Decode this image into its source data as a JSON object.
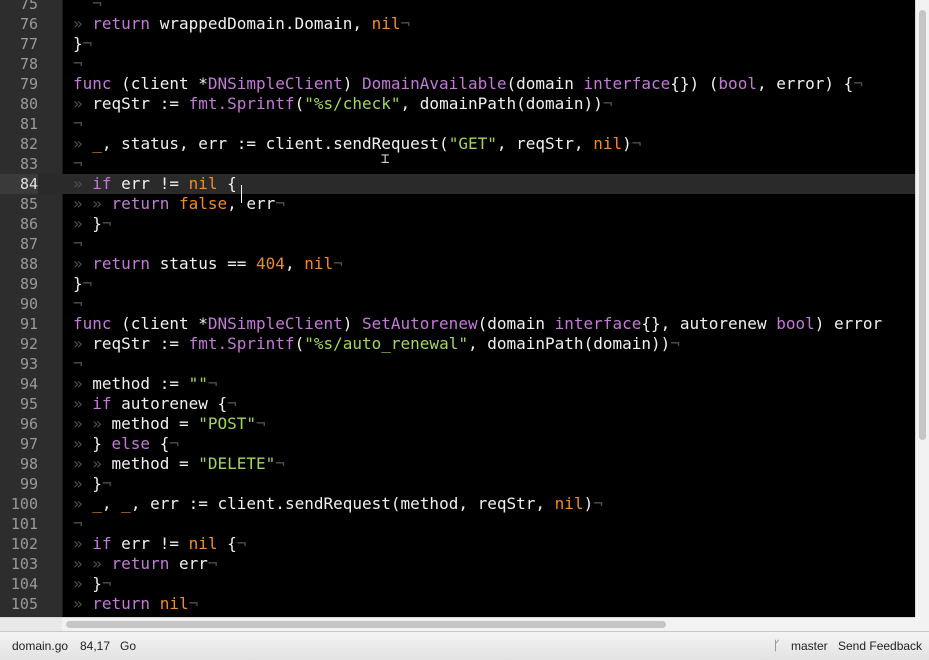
{
  "editor": {
    "current_line": 84,
    "lines": [
      {
        "n": "75",
        "tokens": [
          [
            "ws",
            "  "
          ],
          [
            "eol",
            "¬"
          ]
        ]
      },
      {
        "n": "76",
        "tokens": [
          [
            "ws",
            "» "
          ],
          [
            "kw",
            "return"
          ],
          [
            "text",
            " wrappedDomain.Domain, "
          ],
          [
            "const",
            "nil"
          ],
          [
            "eol",
            "¬"
          ]
        ]
      },
      {
        "n": "77",
        "tokens": [
          [
            "text",
            "}"
          ],
          [
            "eol",
            "¬"
          ]
        ]
      },
      {
        "n": "78",
        "tokens": [
          [
            "eol",
            "¬"
          ]
        ]
      },
      {
        "n": "79",
        "tokens": [
          [
            "kw",
            "func"
          ],
          [
            "text",
            " (client *"
          ],
          [
            "type",
            "DNSimpleClient"
          ],
          [
            "text",
            ") "
          ],
          [
            "fn",
            "DomainAvailable"
          ],
          [
            "text",
            "(domain "
          ],
          [
            "kw",
            "interface"
          ],
          [
            "text",
            "{}) ("
          ],
          [
            "type",
            "bool"
          ],
          [
            "text",
            ", error) {"
          ],
          [
            "eol",
            "¬"
          ]
        ]
      },
      {
        "n": "80",
        "tokens": [
          [
            "ws",
            "» "
          ],
          [
            "text",
            "reqStr := "
          ],
          [
            "fn",
            "fmt.Sprintf"
          ],
          [
            "text",
            "("
          ],
          [
            "str",
            "\"%s/check\""
          ],
          [
            "text",
            ", domainPath(domain))"
          ],
          [
            "eol",
            "¬"
          ]
        ]
      },
      {
        "n": "81",
        "tokens": [
          [
            "eol",
            "¬"
          ]
        ]
      },
      {
        "n": "82",
        "tokens": [
          [
            "ws",
            "» "
          ],
          [
            "const",
            "_"
          ],
          [
            "text",
            ", status, err := client.sendRequest("
          ],
          [
            "str",
            "\"GET\""
          ],
          [
            "text",
            ", reqStr, "
          ],
          [
            "const",
            "nil"
          ],
          [
            "text",
            ")"
          ],
          [
            "eol",
            "¬"
          ]
        ]
      },
      {
        "n": "83",
        "tokens": [
          [
            "eol",
            "¬"
          ]
        ]
      },
      {
        "n": "84",
        "tokens": [
          [
            "ws",
            "» "
          ],
          [
            "kw",
            "if"
          ],
          [
            "text",
            " err != "
          ],
          [
            "const",
            "nil"
          ],
          [
            "text",
            " {"
          ]
        ]
      },
      {
        "n": "85",
        "tokens": [
          [
            "ws",
            "» » "
          ],
          [
            "kw",
            "return"
          ],
          [
            "text",
            " "
          ],
          [
            "const",
            "false"
          ],
          [
            "text",
            ", err"
          ],
          [
            "eol",
            "¬"
          ]
        ]
      },
      {
        "n": "86",
        "tokens": [
          [
            "ws",
            "» "
          ],
          [
            "text",
            "}"
          ],
          [
            "eol",
            "¬"
          ]
        ]
      },
      {
        "n": "87",
        "tokens": [
          [
            "eol",
            "¬"
          ]
        ]
      },
      {
        "n": "88",
        "tokens": [
          [
            "ws",
            "» "
          ],
          [
            "kw",
            "return"
          ],
          [
            "text",
            " status == "
          ],
          [
            "num",
            "404"
          ],
          [
            "text",
            ", "
          ],
          [
            "const",
            "nil"
          ],
          [
            "eol",
            "¬"
          ]
        ]
      },
      {
        "n": "89",
        "tokens": [
          [
            "text",
            "}"
          ],
          [
            "eol",
            "¬"
          ]
        ]
      },
      {
        "n": "90",
        "tokens": [
          [
            "eol",
            "¬"
          ]
        ]
      },
      {
        "n": "91",
        "tokens": [
          [
            "kw",
            "func"
          ],
          [
            "text",
            " (client *"
          ],
          [
            "type",
            "DNSimpleClient"
          ],
          [
            "text",
            ") "
          ],
          [
            "fn",
            "SetAutorenew"
          ],
          [
            "text",
            "(domain "
          ],
          [
            "kw",
            "interface"
          ],
          [
            "text",
            "{}, autorenew "
          ],
          [
            "type",
            "bool"
          ],
          [
            "text",
            ") error"
          ]
        ]
      },
      {
        "n": "92",
        "tokens": [
          [
            "ws",
            "» "
          ],
          [
            "text",
            "reqStr := "
          ],
          [
            "fn",
            "fmt.Sprintf"
          ],
          [
            "text",
            "("
          ],
          [
            "str",
            "\"%s/auto_renewal\""
          ],
          [
            "text",
            ", domainPath(domain))"
          ],
          [
            "eol",
            "¬"
          ]
        ]
      },
      {
        "n": "93",
        "tokens": [
          [
            "eol",
            "¬"
          ]
        ]
      },
      {
        "n": "94",
        "tokens": [
          [
            "ws",
            "» "
          ],
          [
            "text",
            "method := "
          ],
          [
            "str",
            "\"\""
          ],
          [
            "eol",
            "¬"
          ]
        ]
      },
      {
        "n": "95",
        "tokens": [
          [
            "ws",
            "» "
          ],
          [
            "kw",
            "if"
          ],
          [
            "text",
            " autorenew {"
          ],
          [
            "eol",
            "¬"
          ]
        ]
      },
      {
        "n": "96",
        "tokens": [
          [
            "ws",
            "» » "
          ],
          [
            "text",
            "method = "
          ],
          [
            "str",
            "\"POST\""
          ],
          [
            "eol",
            "¬"
          ]
        ]
      },
      {
        "n": "97",
        "tokens": [
          [
            "ws",
            "» "
          ],
          [
            "text",
            "} "
          ],
          [
            "kw",
            "else"
          ],
          [
            "text",
            " {"
          ],
          [
            "eol",
            "¬"
          ]
        ]
      },
      {
        "n": "98",
        "tokens": [
          [
            "ws",
            "» » "
          ],
          [
            "text",
            "method = "
          ],
          [
            "str",
            "\"DELETE\""
          ],
          [
            "eol",
            "¬"
          ]
        ]
      },
      {
        "n": "99",
        "tokens": [
          [
            "ws",
            "» "
          ],
          [
            "text",
            "}"
          ],
          [
            "eol",
            "¬"
          ]
        ]
      },
      {
        "n": "100",
        "tokens": [
          [
            "ws",
            "» "
          ],
          [
            "const",
            "_"
          ],
          [
            "text",
            ", "
          ],
          [
            "const",
            "_"
          ],
          [
            "text",
            ", err := client.sendRequest(method, reqStr, "
          ],
          [
            "const",
            "nil"
          ],
          [
            "text",
            ")"
          ],
          [
            "eol",
            "¬"
          ]
        ]
      },
      {
        "n": "101",
        "tokens": [
          [
            "eol",
            "¬"
          ]
        ]
      },
      {
        "n": "102",
        "tokens": [
          [
            "ws",
            "» "
          ],
          [
            "kw",
            "if"
          ],
          [
            "text",
            " err != "
          ],
          [
            "const",
            "nil"
          ],
          [
            "text",
            " {"
          ],
          [
            "eol",
            "¬"
          ]
        ]
      },
      {
        "n": "103",
        "tokens": [
          [
            "ws",
            "» » "
          ],
          [
            "kw",
            "return"
          ],
          [
            "text",
            " err"
          ],
          [
            "eol",
            "¬"
          ]
        ]
      },
      {
        "n": "104",
        "tokens": [
          [
            "ws",
            "» "
          ],
          [
            "text",
            "}"
          ],
          [
            "eol",
            "¬"
          ]
        ]
      },
      {
        "n": "105",
        "tokens": [
          [
            "ws",
            "» "
          ],
          [
            "kw",
            "return"
          ],
          [
            "text",
            " "
          ],
          [
            "const",
            "nil"
          ],
          [
            "eol",
            "¬"
          ]
        ]
      }
    ]
  },
  "statusbar": {
    "filename": "domain.go",
    "position": "84,17",
    "language": "Go",
    "branch_icon": "git-branch-icon",
    "branch": "master",
    "feedback": "Send Feedback"
  },
  "colors": {
    "keyword": "#c27ad6",
    "string": "#a3d65a",
    "constant": "#f08b2a",
    "background": "#000000",
    "gutter": "#2d2d2d"
  }
}
